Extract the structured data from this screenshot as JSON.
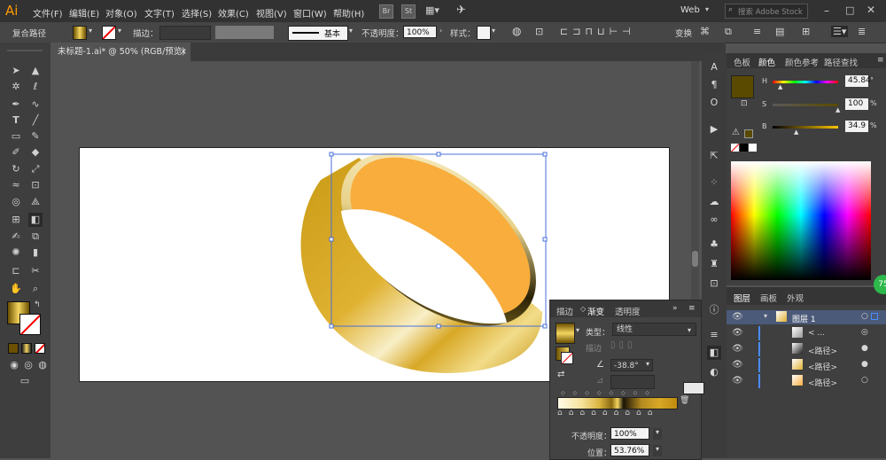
{
  "app": {
    "logo": "Ai"
  },
  "menu": [
    "文件(F)",
    "编辑(E)",
    "对象(O)",
    "文字(T)",
    "选择(S)",
    "效果(C)",
    "视图(V)",
    "窗口(W)",
    "帮助(H)"
  ],
  "menu_badges": {
    "bridge": "Br",
    "stock": "St"
  },
  "workspace": {
    "label": "Web",
    "search_placeholder": "搜索 Adobe Stock"
  },
  "controlbar": {
    "selection_type": "复合路径",
    "stroke_label": "描边：",
    "stroke_style": "基本",
    "opacity_label": "不透明度：",
    "opacity_value": "100%",
    "style_label": "样式：",
    "transform_label": "变换"
  },
  "document": {
    "tab_title": "未标题-1.ai* @ 50% (RGB/预览)",
    "close_glyph": "×"
  },
  "dock_icons": [
    "text-icon",
    "paragraph-icon",
    "opentype-icon",
    "play-icon",
    "export-icon",
    "symbols-icon",
    "swatches-libraries-icon",
    "links-icon",
    "clubs-icon",
    "puppet-icon",
    "transform-icon",
    "info-icon",
    "align-icon",
    "gradient-icon",
    "transparency-icon"
  ],
  "color_panel": {
    "tabs": [
      "色板",
      "颜色",
      "颜色参考",
      "路径查找"
    ],
    "active_tab": "颜色",
    "swatch_color": "#5a4a00",
    "h": {
      "label": "H",
      "value": "45.84",
      "unit": "°"
    },
    "s": {
      "label": "S",
      "value": "100",
      "unit": "%"
    },
    "b": {
      "label": "B",
      "value": "34.9",
      "unit": "%"
    }
  },
  "layers_panel": {
    "tabs": [
      "图层",
      "画板",
      "外观"
    ],
    "active_tab": "图层",
    "layer_name": "图层 1",
    "items": [
      "< ...",
      "<路径>",
      "<路径>",
      "<路径>"
    ]
  },
  "gradient_panel": {
    "tabs": [
      "描边",
      "渐变",
      "透明度"
    ],
    "active_tab": "渐变",
    "type_label": "类型：",
    "type_value": "线性",
    "stroke_label": "描边",
    "angle_value": "-38.8°",
    "opacity_label": "不透明度：",
    "opacity_value": "100%",
    "position_label": "位置：",
    "position_value": "53.76%"
  },
  "badge": {
    "value": "75"
  },
  "colors": {
    "gold": "#e0b030",
    "inner": "#f8ad3c",
    "selection": "#4a6fd8",
    "accent": "#ff9a00"
  }
}
